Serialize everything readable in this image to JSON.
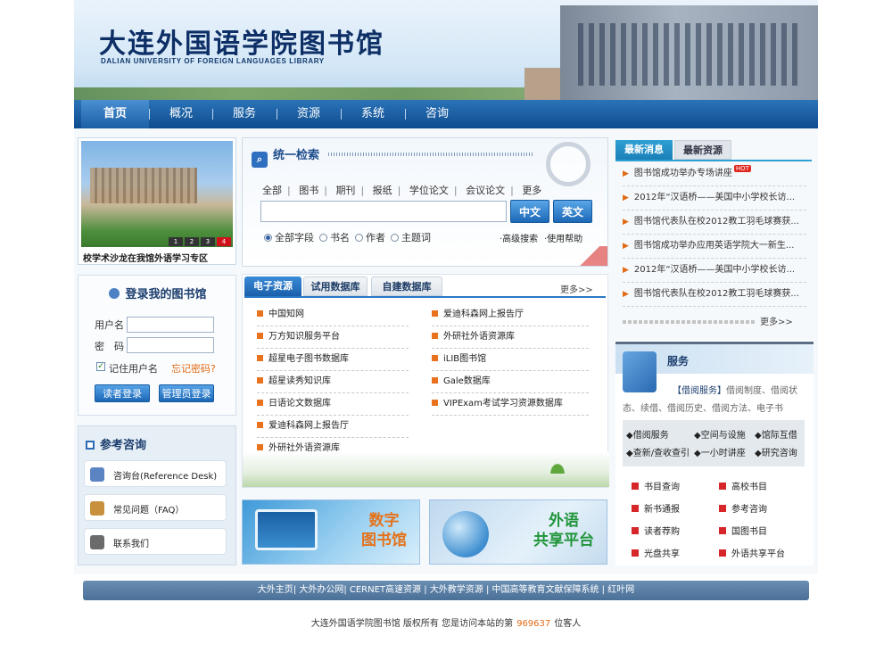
{
  "header": {
    "logo_cn": "大连外国语学院图书馆",
    "logo_en": "DALIAN UNIVERSITY OF FOREIGN LANGUAGES LIBRARY"
  },
  "nav": {
    "items": [
      "首页",
      "概况",
      "服务",
      "资源",
      "系统",
      "咨询"
    ]
  },
  "slideshow": {
    "caption": "校学术沙龙在我馆外语学习专区",
    "pages": [
      "1",
      "2",
      "3",
      "4"
    ]
  },
  "login": {
    "title": "登录我的图书馆",
    "username_label": "用户名",
    "password_label": "密　码",
    "remember_label": "记住用户名",
    "forgot_label": "忘记密码?",
    "reader_login": "读者登录",
    "admin_login": "管理员登录"
  },
  "reference": {
    "title": "参考咨询",
    "items": [
      "咨询台(Reference Desk)",
      "常见问题（FAQ）",
      "联系我们"
    ]
  },
  "search": {
    "title": "统一检索",
    "categories": [
      "全部",
      "图书",
      "期刊",
      "报纸",
      "学位论文",
      "会议论文",
      "更多"
    ],
    "btn_cn": "中文",
    "btn_en": "英文",
    "fields": [
      "全部字段",
      "书名",
      "作者",
      "主题词"
    ],
    "advanced": "·高级搜索",
    "help": "·使用帮助"
  },
  "resources": {
    "tabs": [
      "电子资源",
      "试用数据库",
      "自建数据库"
    ],
    "more": "更多>>",
    "left": [
      "中国知网",
      "万方知识服务平台",
      "超星电子图书数据库",
      "超星读秀知识库",
      "日语论文数据库",
      "爱迪科森网上报告厅",
      "外研社外语资源库"
    ],
    "right": [
      "爱迪科森网上报告厅",
      "外研社外语资源库",
      "iLIB图书馆",
      "Gale数据库",
      "VIPExam考试学习资源数据库"
    ]
  },
  "banners": {
    "digital": "数字图书馆",
    "digital_l1": "数字",
    "digital_l2": "图书馆",
    "share_l1": "外语",
    "share_l2": "共享平台"
  },
  "news": {
    "tabs": [
      "最新消息",
      "最新资源"
    ],
    "hot": "HOT",
    "items": [
      "图书馆成功举办专场讲座",
      "2012年“汉语桥——美国中小学校长访...",
      "图书馆代表队在校2012教工羽毛球赛获...",
      "图书馆成功举办应用英语学院大一新生...",
      "2012年“汉语桥——美国中小学校长访...",
      "图书馆代表队在校2012教工羽毛球赛获..."
    ],
    "more": "更多>>"
  },
  "services": {
    "title": "服务",
    "desc_head": "【借阅服务】",
    "desc_body": "借阅制度、借阅状态、续借、借阅历史、借阅方法、电子书",
    "box": [
      "◆借阅服务",
      "◆空间与设施",
      "◆馆际互借",
      "◆查新/查收查引",
      "◆一小时讲座",
      "◆研究咨询"
    ],
    "links": [
      "书目查询",
      "高校书目",
      "新书通报",
      "参考咨询",
      "读者荐购",
      "国图书目",
      "光盘共享",
      "外语共享平台"
    ]
  },
  "footer": {
    "links": "大外主页| 大外办公网| CERNET高速资源 | 大外教学资源 | 中国高等教育文献保障系统 | 红叶网",
    "copyright": "大连外国语学院图书馆  版权所有      您是访问本站的第",
    "counter": "969637",
    "visitor": "位客人"
  }
}
